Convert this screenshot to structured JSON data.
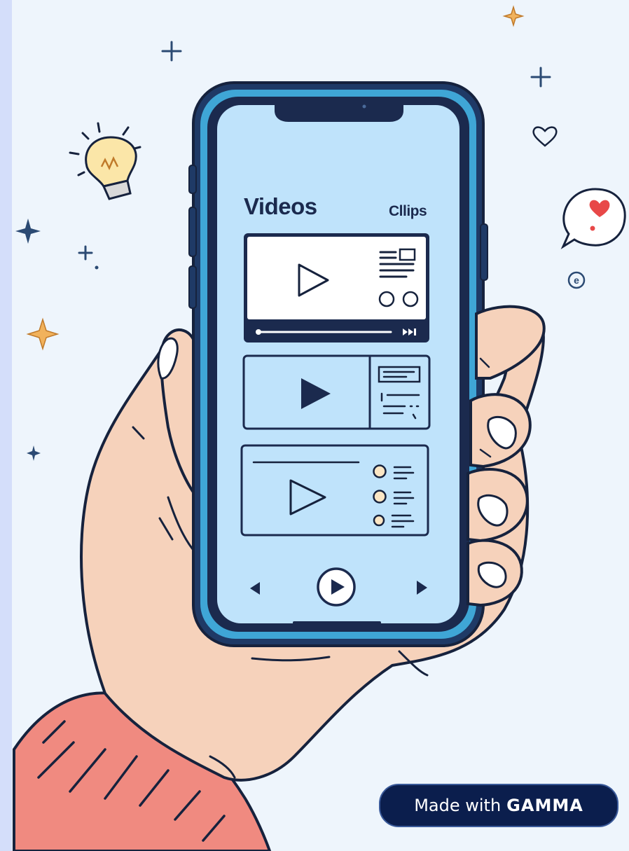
{
  "phone": {
    "title": "Videos",
    "tab": "Cllips"
  },
  "badge": {
    "prefix": "Made with",
    "brand": "GAMMA"
  },
  "colors": {
    "background": "#eef5fc",
    "screen": "#bfe3fb",
    "frame": "#1f3a66",
    "skin": "#f6d2bb",
    "sleeve": "#f08a80",
    "outline": "#16223d",
    "badge": "#0b1e4d"
  }
}
